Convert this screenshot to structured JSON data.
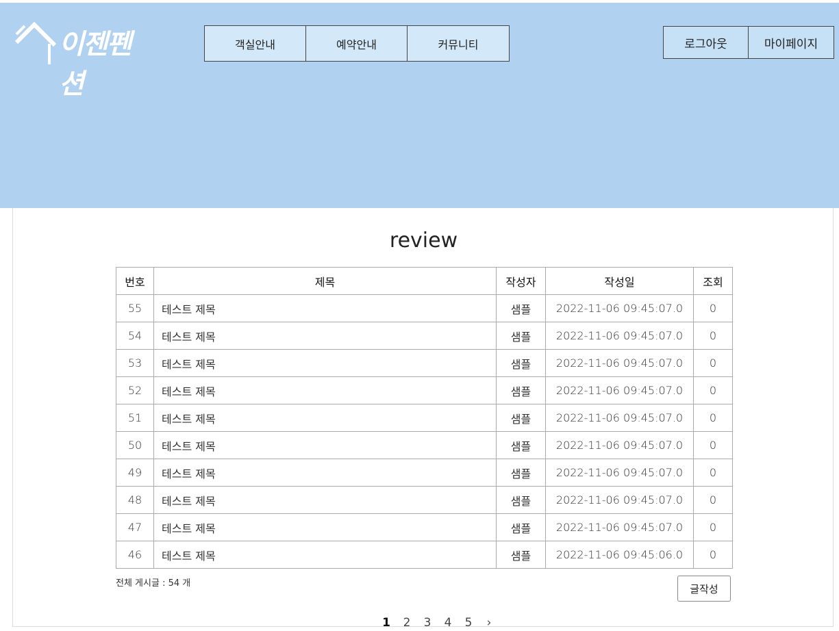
{
  "header": {
    "logo_text": "이젠펜션",
    "main_nav": [
      "객실안내",
      "예약안내",
      "커뮤니티"
    ],
    "user_nav": [
      "로그아웃",
      "마이페이지"
    ],
    "colors": {
      "header_bg": "#b0d2f0",
      "nav_bg": "#d3e8f8"
    }
  },
  "page": {
    "title": "review"
  },
  "table": {
    "columns": [
      "번호",
      "제목",
      "작성자",
      "작성일",
      "조회"
    ],
    "rows": [
      [
        "55",
        "테스트 제목",
        "샘플",
        "2022-11-06 09:45:07.0",
        "0"
      ],
      [
        "54",
        "테스트 제목",
        "샘플",
        "2022-11-06 09:45:07.0",
        "0"
      ],
      [
        "53",
        "테스트 제목",
        "샘플",
        "2022-11-06 09:45:07.0",
        "0"
      ],
      [
        "52",
        "테스트 제목",
        "샘플",
        "2022-11-06 09:45:07.0",
        "0"
      ],
      [
        "51",
        "테스트 제목",
        "샘플",
        "2022-11-06 09:45:07.0",
        "0"
      ],
      [
        "50",
        "테스트 제목",
        "샘플",
        "2022-11-06 09:45:07.0",
        "0"
      ],
      [
        "49",
        "테스트 제목",
        "샘플",
        "2022-11-06 09:45:07.0",
        "0"
      ],
      [
        "48",
        "테스트 제목",
        "샘플",
        "2022-11-06 09:45:07.0",
        "0"
      ],
      [
        "47",
        "테스트 제목",
        "샘플",
        "2022-11-06 09:45:07.0",
        "0"
      ],
      [
        "46",
        "테스트 제목",
        "샘플",
        "2022-11-06 09:45:06.0",
        "0"
      ]
    ]
  },
  "footer": {
    "total_text": "전체 게시글 : 54 개",
    "write_button": "글작성"
  },
  "pagination": {
    "pages": [
      "1",
      "2",
      "3",
      "4",
      "5"
    ],
    "current": "1",
    "next_icon": "chevron-right-icon",
    "next_glyph": "›"
  }
}
